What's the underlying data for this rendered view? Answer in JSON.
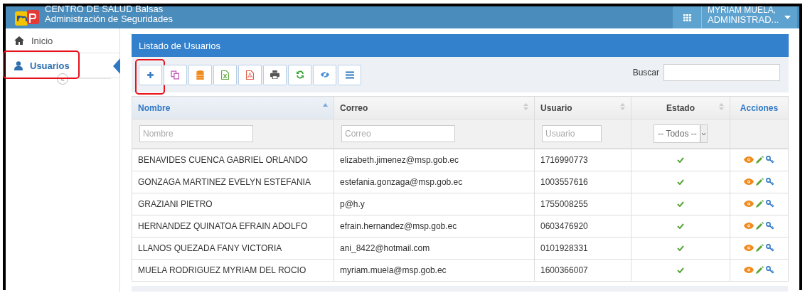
{
  "header": {
    "org": "CENTRO DE SALUD Balsas",
    "subtitle": "Administración de Seguridades",
    "user_line1": "MYRIAM MUELA,",
    "user_line2": "ADMINISTRAD..."
  },
  "sidebar": {
    "items": [
      {
        "label": "Inicio",
        "kind": "home",
        "selected": false,
        "highlighted": false
      },
      {
        "label": "Usuarios",
        "kind": "user",
        "selected": true,
        "highlighted": true
      }
    ],
    "collapse": "«"
  },
  "panel": {
    "title": "Listado de Usuarios",
    "toolbar": [
      {
        "kind": "add",
        "highlighted": true
      },
      {
        "kind": "copy",
        "highlighted": false
      },
      {
        "kind": "database",
        "highlighted": false
      },
      {
        "kind": "excel",
        "highlighted": false
      },
      {
        "kind": "pdf",
        "highlighted": false
      },
      {
        "kind": "print",
        "highlighted": false
      },
      {
        "kind": "refresh",
        "highlighted": false
      },
      {
        "kind": "visibility",
        "highlighted": false
      },
      {
        "kind": "columns",
        "highlighted": false
      }
    ],
    "search_label": "Buscar",
    "table": {
      "columns": [
        {
          "label": "Nombre",
          "kind": "text",
          "sorted": true,
          "placeholder": "Nombre"
        },
        {
          "label": "Correo",
          "kind": "text",
          "sorted": false,
          "placeholder": "Correo"
        },
        {
          "label": "Usuario",
          "kind": "text",
          "sorted": false,
          "placeholder": "Usuario"
        },
        {
          "label": "Estado",
          "kind": "select",
          "sorted": false,
          "value": "-- Todos --"
        },
        {
          "label": "Acciones",
          "kind": "actions"
        }
      ],
      "rows": [
        {
          "nombre": "BENAVIDES CUENCA GABRIEL ORLANDO",
          "correo": "elizabeth.jimenez@msp.gob.ec",
          "usuario": "1716990773",
          "active": true
        },
        {
          "nombre": "GONZAGA MARTINEZ EVELYN ESTEFANIA",
          "correo": "estefania.gonzaga@msp.gob.ec",
          "usuario": "1003557616",
          "active": true
        },
        {
          "nombre": "GRAZIANI PIETRO",
          "correo": "p@h.y",
          "usuario": "1755008255",
          "active": true
        },
        {
          "nombre": "HERNANDEZ QUINATOA EFRAIN ADOLFO",
          "correo": "efrain.hernandez@msp.gob.ec",
          "usuario": "0603476920",
          "active": true
        },
        {
          "nombre": "LLANOS QUEZADA FANY VICTORIA",
          "correo": "ani_8422@hotmail.com",
          "usuario": "0101928331",
          "active": true
        },
        {
          "nombre": "MUELA RODRIGUEZ MYRIAM DEL ROCIO",
          "correo": "myriam.muela@msp.gob.ec",
          "usuario": "1600366007",
          "active": true
        }
      ]
    }
  }
}
